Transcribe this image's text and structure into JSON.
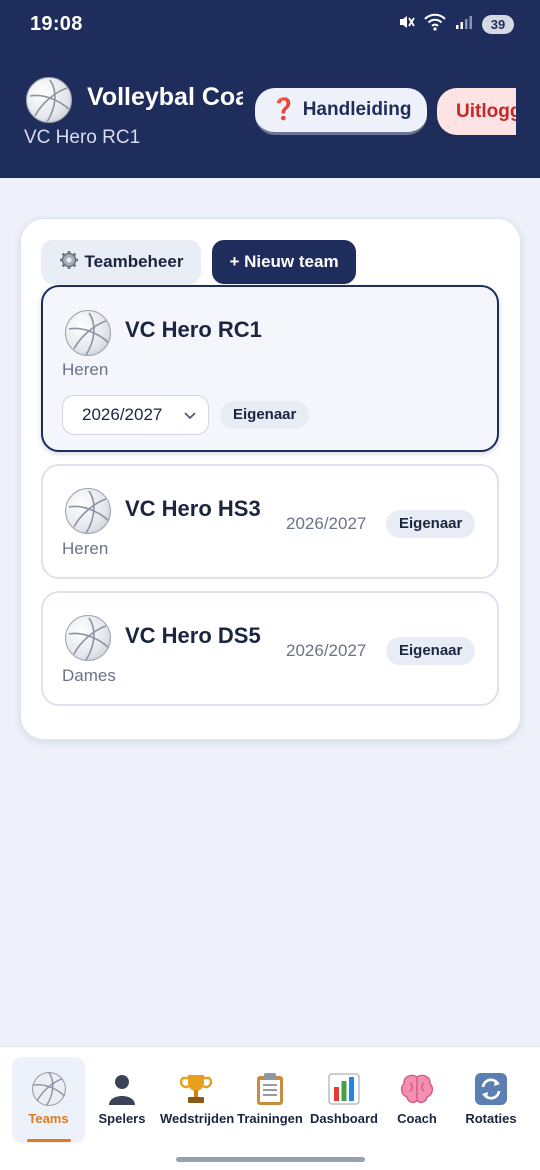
{
  "status_bar": {
    "time": "19:08",
    "battery": "39"
  },
  "header": {
    "title": "Volleybal Coa",
    "subtitle": "VC Hero RC1",
    "help_label": "Handleiding",
    "logout_label": "Uitlogg"
  },
  "toolbar": {
    "teambeheer_label": "Teambeheer",
    "new_team_label": "+ Nieuw team"
  },
  "teams": [
    {
      "name": "VC Hero RC1",
      "gender": "Heren",
      "season": "2026/2027",
      "role": "Eigenaar",
      "selected": true
    },
    {
      "name": "VC Hero HS3",
      "gender": "Heren",
      "season": "2026/2027",
      "role": "Eigenaar",
      "selected": false
    },
    {
      "name": "VC Hero DS5",
      "gender": "Dames",
      "season": "2026/2027",
      "role": "Eigenaar",
      "selected": false
    }
  ],
  "nav": [
    {
      "label": "Teams",
      "icon": "volleyball-icon",
      "active": true
    },
    {
      "label": "Spelers",
      "icon": "person-icon",
      "active": false
    },
    {
      "label": "Wedstrijden",
      "icon": "trophy-icon",
      "active": false
    },
    {
      "label": "Trainingen",
      "icon": "clipboard-icon",
      "active": false
    },
    {
      "label": "Dashboard",
      "icon": "bar-chart-icon",
      "active": false
    },
    {
      "label": "Coach",
      "icon": "brain-icon",
      "active": false
    },
    {
      "label": "Rotaties",
      "icon": "rotate-icon",
      "active": false
    }
  ],
  "colors": {
    "primary": "#1f2d5c",
    "accent": "#e07a1f",
    "danger": "#c62828"
  }
}
